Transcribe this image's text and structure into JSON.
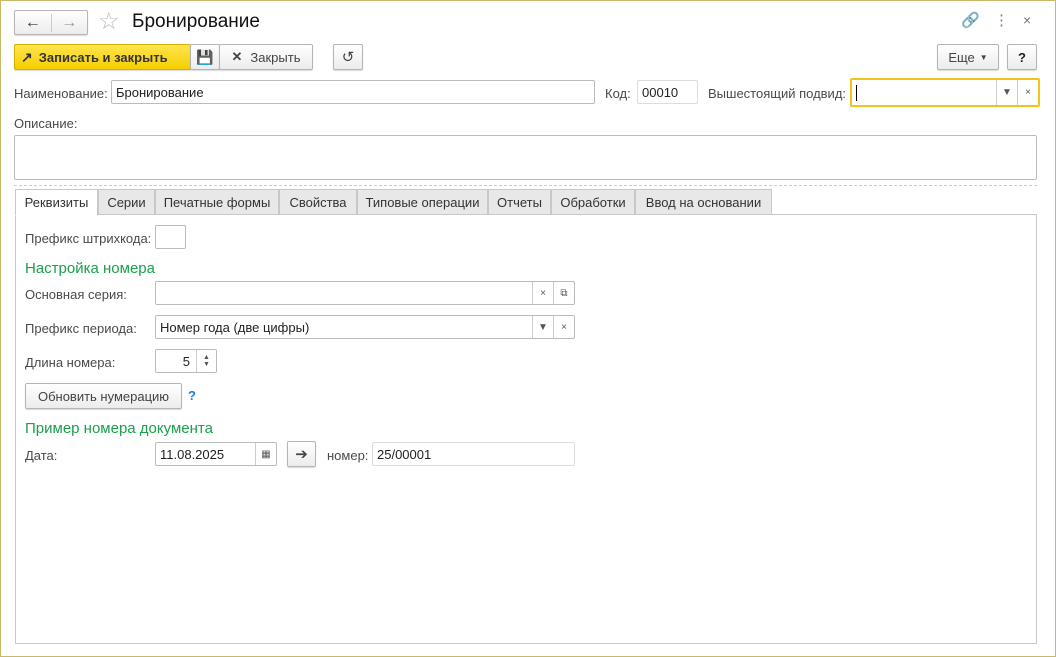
{
  "window": {
    "title": "Бронирование"
  },
  "toolbar": {
    "save_close": "Записать и закрыть",
    "close": "Закрыть",
    "more": "Еще",
    "help": "?"
  },
  "header": {
    "name_label": "Наименование:",
    "name_value": "Бронирование",
    "code_label": "Код:",
    "code_value": "00010",
    "parent_label": "Вышестоящий подвид:",
    "parent_value": "",
    "description_label": "Описание:",
    "description_value": ""
  },
  "tabs": [
    {
      "label": "Реквизиты"
    },
    {
      "label": "Серии"
    },
    {
      "label": "Печатные формы"
    },
    {
      "label": "Свойства"
    },
    {
      "label": "Типовые операции"
    },
    {
      "label": "Отчеты"
    },
    {
      "label": "Обработки"
    },
    {
      "label": "Ввод на основании"
    }
  ],
  "details": {
    "barcode_prefix_label": "Префикс штрихкода:",
    "barcode_prefix_value": "",
    "numbering_heading": "Настройка номера",
    "main_series_label": "Основная серия:",
    "main_series_value": "",
    "period_prefix_label": "Префикс периода:",
    "period_prefix_value": "Номер года (две цифры)",
    "number_length_label": "Длина номера:",
    "number_length_value": "5",
    "refresh_button": "Обновить нумерацию",
    "help_mark": "?",
    "example_heading": "Пример номера документа",
    "date_label": "Дата:",
    "date_value": "11.08.2025",
    "number_label": "номер:",
    "number_value": "25/00001"
  }
}
